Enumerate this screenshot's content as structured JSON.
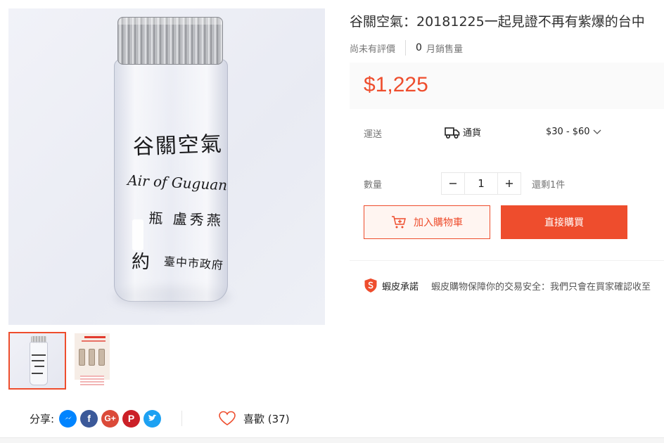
{
  "product": {
    "title": "谷關空氣：20181225一起見證不再有紫爆的台中",
    "rating_text": "尚未有評價",
    "sold_count": "0",
    "sold_label": "月銷售量",
    "price": "$1,225"
  },
  "main_image": {
    "jar_label_lines": [
      "谷關空氣",
      "Air of Guguan",
      "瓶 盧秀燕",
      "約",
      "臺中市政府"
    ]
  },
  "thumbnails": [
    {
      "selected": true
    },
    {
      "selected": false
    }
  ],
  "shipping": {
    "label": "運送",
    "method": "通貨",
    "fee": "$30 - $60"
  },
  "quantity": {
    "label": "數量",
    "value": "1",
    "stock_text": "還剩1件"
  },
  "buttons": {
    "add_to_cart": "加入購物車",
    "buy_now": "直接購買"
  },
  "guarantee": {
    "title": "蝦皮承諾",
    "text": "蝦皮購物保障你的交易安全：我們只會在買家確認收至"
  },
  "share": {
    "label": "分享:",
    "icons": [
      "messenger-icon",
      "facebook-icon",
      "google-plus-icon",
      "pinterest-icon",
      "twitter-icon"
    ]
  },
  "like": {
    "label": "喜歡 (37)"
  },
  "colors": {
    "accent": "#ee4d2d",
    "accent_light": "#fff5f1",
    "messenger": "#0084ff",
    "facebook": "#3b5999",
    "google_plus": "#db4a39",
    "pinterest": "#cb2027",
    "twitter": "#1da1f2"
  }
}
